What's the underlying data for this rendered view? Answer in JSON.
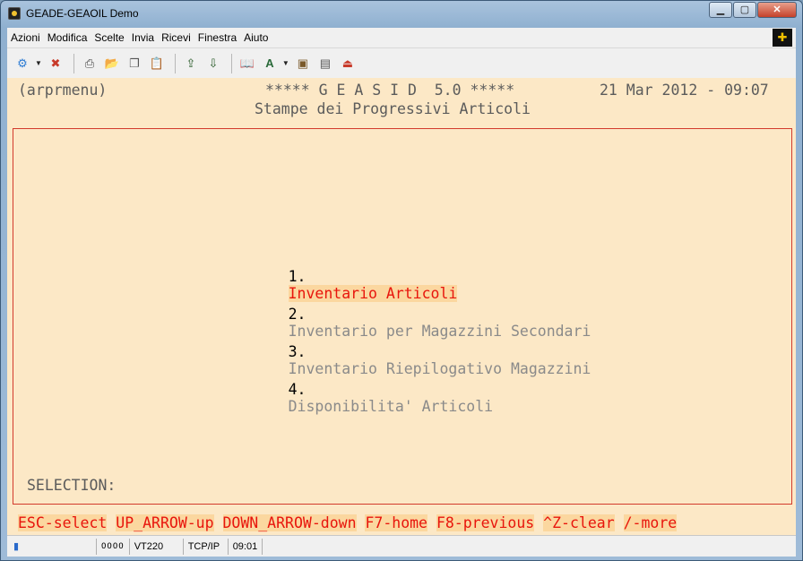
{
  "window": {
    "title": "GEADE-GEAOIL Demo",
    "min_label": "▁",
    "max_label": "▢",
    "close_label": "✕"
  },
  "menu": {
    "items": [
      "Azioni",
      "Modifica",
      "Scelte",
      "Invia",
      "Ricevi",
      "Finestra",
      "Aiuto"
    ],
    "logo_glyph": "✚"
  },
  "toolbar": {
    "icons": [
      {
        "name": "connect-icon",
        "glyph": "⚙"
      },
      {
        "name": "disconnect-icon",
        "glyph": "✖"
      },
      {
        "name": "print-icon",
        "glyph": "⎙"
      },
      {
        "name": "open-folder-icon",
        "glyph": "📂"
      },
      {
        "name": "copy-icon",
        "glyph": "❐"
      },
      {
        "name": "paste-icon",
        "glyph": "📋"
      },
      {
        "name": "send-file-icon",
        "glyph": "⇪"
      },
      {
        "name": "receive-file-icon",
        "glyph": "⇩"
      },
      {
        "name": "book-icon",
        "glyph": "📖"
      },
      {
        "name": "font-icon",
        "glyph": "A"
      },
      {
        "name": "settings-icon",
        "glyph": "▣"
      },
      {
        "name": "properties-icon",
        "glyph": "▤"
      },
      {
        "name": "exit-icon",
        "glyph": "⏏"
      }
    ]
  },
  "terminal": {
    "program": "(arprmenu)",
    "header": "***** G E A S I D  5.0 *****",
    "datetime": "21 Mar 2012 - 09:07",
    "subtitle": "Stampe dei Progressivi Articoli",
    "options": [
      {
        "num": "1.",
        "label": "Inventario Articoli",
        "selected": true
      },
      {
        "num": "2.",
        "label": "Inventario per Magazzini Secondari",
        "selected": false
      },
      {
        "num": "3.",
        "label": "Inventario Riepilogativo Magazzini",
        "selected": false
      },
      {
        "num": "4.",
        "label": "Disponibilita' Articoli",
        "selected": false
      }
    ],
    "prompt": "SELECTION:",
    "keys": [
      "ESC-select",
      "UP_ARROW-up",
      "DOWN_ARROW-down",
      "F7-home",
      "F8-previous",
      "^Z-clear",
      "/-more"
    ]
  },
  "status": {
    "leds": "OOOO",
    "emulation": "VT220",
    "protocol": "TCP/IP",
    "time": "09:01"
  },
  "colors": {
    "terminal_bg": "#fce8c6",
    "accent_red": "#e8150c",
    "highlight": "#fbd79f"
  }
}
